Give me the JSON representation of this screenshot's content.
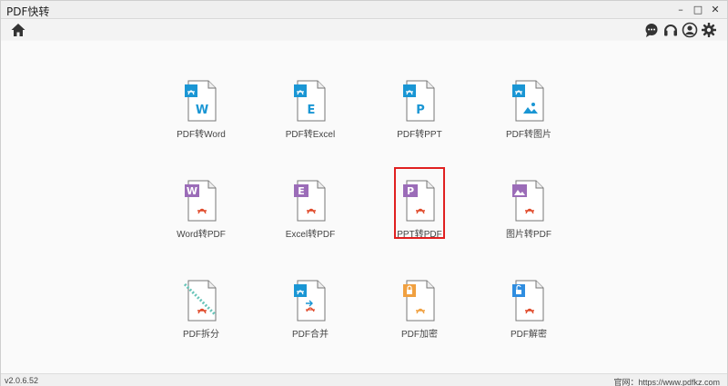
{
  "window": {
    "title": "PDF快转",
    "controls": [
      "–",
      "□",
      "✕"
    ]
  },
  "toolbar": {
    "left_icons": [
      "home-icon"
    ],
    "right_icons": [
      "chat-icon",
      "headset-icon",
      "user-icon",
      "gear-icon"
    ]
  },
  "tiles": [
    {
      "label": "PDF转Word",
      "icon": "pdf-to-word-icon",
      "accent": "#1a96d4",
      "letter": "W"
    },
    {
      "label": "PDF转Excel",
      "icon": "pdf-to-excel-icon",
      "accent": "#1a96d4",
      "letter": "E"
    },
    {
      "label": "PDF转PPT",
      "icon": "pdf-to-ppt-icon",
      "accent": "#1a96d4",
      "letter": "P"
    },
    {
      "label": "PDF转图片",
      "icon": "pdf-to-image-icon",
      "accent": "#1a96d4",
      "letter": ""
    },
    {
      "label": "Word转PDF",
      "icon": "word-to-pdf-icon",
      "accent": "#9b6cb8",
      "letter": "W"
    },
    {
      "label": "Excel转PDF",
      "icon": "excel-to-pdf-icon",
      "accent": "#9b6cb8",
      "letter": "E"
    },
    {
      "label": "PPT转PDF",
      "icon": "ppt-to-pdf-icon",
      "accent": "#9b6cb8",
      "letter": "P"
    },
    {
      "label": "图片转PDF",
      "icon": "image-to-pdf-icon",
      "accent": "#9b6cb8",
      "letter": ""
    },
    {
      "label": "PDF拆分",
      "icon": "pdf-split-icon",
      "accent": "#66c4b8",
      "letter": ""
    },
    {
      "label": "PDF合并",
      "icon": "pdf-merge-icon",
      "accent": "#1a96d4",
      "letter": ""
    },
    {
      "label": "PDF加密",
      "icon": "pdf-encrypt-icon",
      "accent": "#f0a040",
      "letter": ""
    },
    {
      "label": "PDF解密",
      "icon": "pdf-decrypt-icon",
      "accent": "#2f8de0",
      "letter": ""
    }
  ],
  "highlighted_tile": "PPT转PDF",
  "status": {
    "version": "v2.0.6.52",
    "website": "官网：https://www.pdfkz.com"
  },
  "colors": {
    "pdf_red": "#e04a2a",
    "highlight_red": "#e02020",
    "blue_accent": "#1a96d4",
    "purple_accent": "#9b6cb8"
  }
}
